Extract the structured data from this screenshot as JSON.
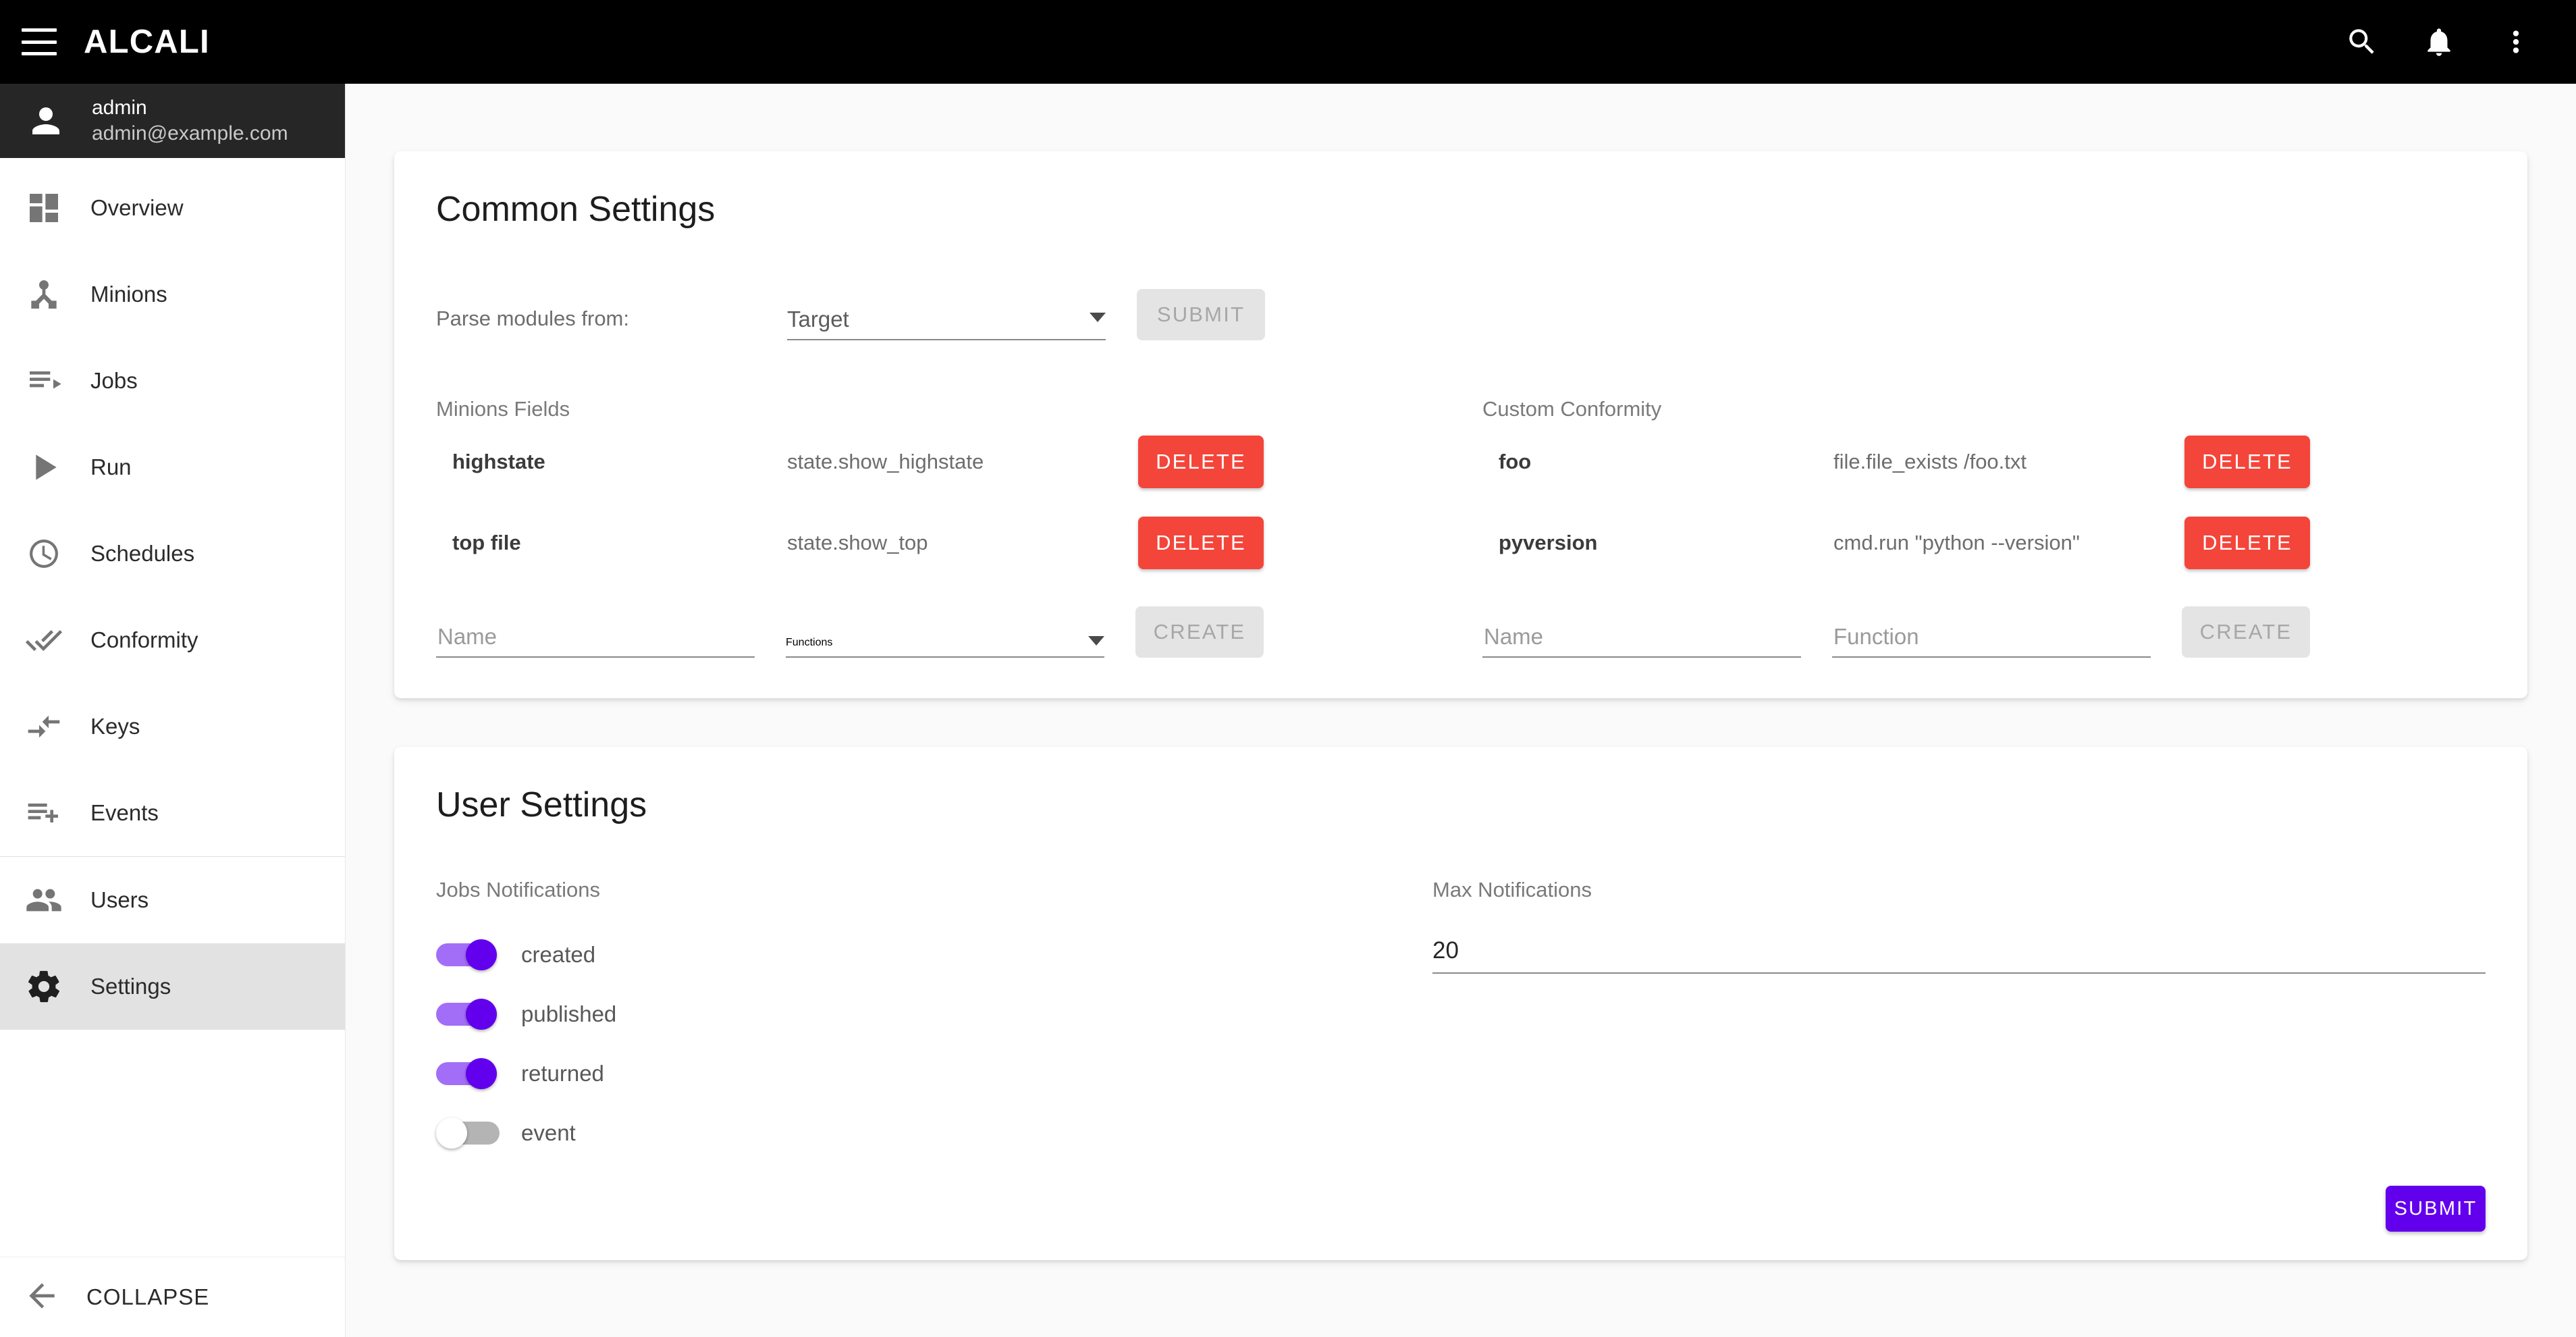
{
  "topbar": {
    "brand": "ALCALI",
    "menu_icon": "hamburger-menu-icon",
    "search_icon": "search-icon",
    "notifications_icon": "bell-icon",
    "more_icon": "more-vertical-icon"
  },
  "sidebar": {
    "user": {
      "name": "admin",
      "email": "admin@example.com",
      "avatar_icon": "person-icon"
    },
    "items": [
      {
        "label": "Overview",
        "icon": "dashboard-icon",
        "active": false
      },
      {
        "label": "Minions",
        "icon": "device-hub-icon",
        "active": false
      },
      {
        "label": "Jobs",
        "icon": "playlist-play-icon",
        "active": false
      },
      {
        "label": "Run",
        "icon": "play-arrow-icon",
        "active": false
      },
      {
        "label": "Schedules",
        "icon": "clock-icon",
        "active": false
      },
      {
        "label": "Conformity",
        "icon": "done-all-icon",
        "active": false
      },
      {
        "label": "Keys",
        "icon": "compare-arrows-icon",
        "active": false
      },
      {
        "label": "Events",
        "icon": "playlist-add-icon",
        "active": false
      },
      {
        "label": "Users",
        "icon": "people-icon",
        "active": false
      },
      {
        "label": "Settings",
        "icon": "gear-icon",
        "active": true
      }
    ],
    "collapse": {
      "label": "COLLAPSE",
      "icon": "arrow-back-icon"
    }
  },
  "common_settings": {
    "title": "Common Settings",
    "parse_label": "Parse modules from:",
    "parse_select_value": "Target",
    "submit_label": "SUBMIT",
    "minions_fields": {
      "section_label": "Minions Fields",
      "rows": [
        {
          "name": "highstate",
          "value": "state.show_highstate",
          "delete_label": "DELETE"
        },
        {
          "name": "top file",
          "value": "state.show_top",
          "delete_label": "DELETE"
        }
      ],
      "create": {
        "name_placeholder": "Name",
        "function_placeholder": "Functions",
        "create_label": "CREATE"
      }
    },
    "custom_conformity": {
      "section_label": "Custom Conformity",
      "rows": [
        {
          "name": "foo",
          "value": "file.file_exists /foo.txt",
          "delete_label": "DELETE"
        },
        {
          "name": "pyversion",
          "value": "cmd.run \"python --version\"",
          "delete_label": "DELETE"
        }
      ],
      "create": {
        "name_placeholder": "Name",
        "function_placeholder": "Function",
        "create_label": "CREATE"
      }
    }
  },
  "user_settings": {
    "title": "User Settings",
    "jobs_notifications_label": "Jobs Notifications",
    "toggles": [
      {
        "label": "created",
        "on": true
      },
      {
        "label": "published",
        "on": true
      },
      {
        "label": "returned",
        "on": true
      },
      {
        "label": "event",
        "on": false
      }
    ],
    "max_notifications_label": "Max Notifications",
    "max_notifications_value": "20",
    "submit_label": "SUBMIT"
  },
  "colors": {
    "accent_purple": "#6200ee",
    "toggle_track_on": "#a36ef7",
    "delete_red": "#f4453b",
    "topbar_black": "#000000",
    "page_background": "#fafafa",
    "card_background": "#ffffff"
  }
}
